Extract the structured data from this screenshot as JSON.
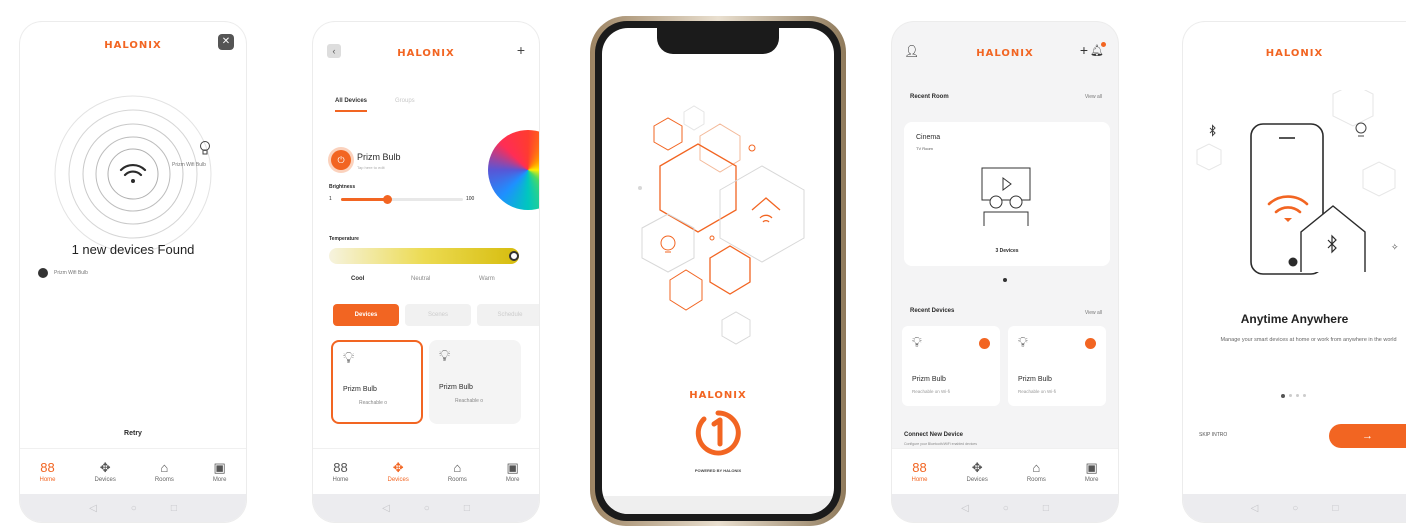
{
  "brand": {
    "name": "HALONIX",
    "accent": "#f26522"
  },
  "screen1": {
    "device_tag": "Prizm Wifi Bulb",
    "found_title": "1 new devices Found",
    "found_item": "Prizm Wifi Bulb",
    "retry_label": "Retry",
    "nav": [
      "Home",
      "Devices",
      "Rooms",
      "More"
    ]
  },
  "screen2": {
    "tabs": [
      "All Devices",
      "Groups"
    ],
    "device_name": "Prizm Bulb",
    "device_sub": "Tap here to edit",
    "brightness_label": "Brightness",
    "brightness_min": "1",
    "brightness_max": "100",
    "brightness_value": 0.38,
    "temperature_label": "Temperature",
    "temp_options": [
      "Cool",
      "Neutral",
      "Warm"
    ],
    "chips": [
      "Devices",
      "Scenes",
      "Schedule"
    ],
    "cards": [
      {
        "name": "Prizm Bulb",
        "status": "Reachable o"
      },
      {
        "name": "Prizm Bulb",
        "status": "Reachable o"
      }
    ],
    "nav": [
      "Home",
      "Devices",
      "Rooms",
      "More"
    ]
  },
  "screen3": {
    "powered_by": "POWERED BY HALONIX"
  },
  "screen4": {
    "recent_room_title": "Recent Room",
    "view_all": "View all",
    "room_name": "Cinema",
    "room_sub": "TV Room",
    "room_devices": "3 Devices",
    "recent_devices_title": "Recent Devices",
    "devices": [
      {
        "name": "Prizm Bulb",
        "status": "Reachable on Wi-fi"
      },
      {
        "name": "Prizm Bulb",
        "status": "Reachable on Wi-fi"
      }
    ],
    "connect_title": "Connect New Device",
    "connect_sub": "Configure your Bluetooth/WiFi enabled devices",
    "nav": [
      "Home",
      "Devices",
      "Rooms",
      "More"
    ]
  },
  "screen5": {
    "headline": "Anytime Anywhere",
    "body": "Manage your smart devices at home or work from anywhere in the world",
    "skip_label": "SKIP INTRO",
    "next_arrow": "→"
  }
}
